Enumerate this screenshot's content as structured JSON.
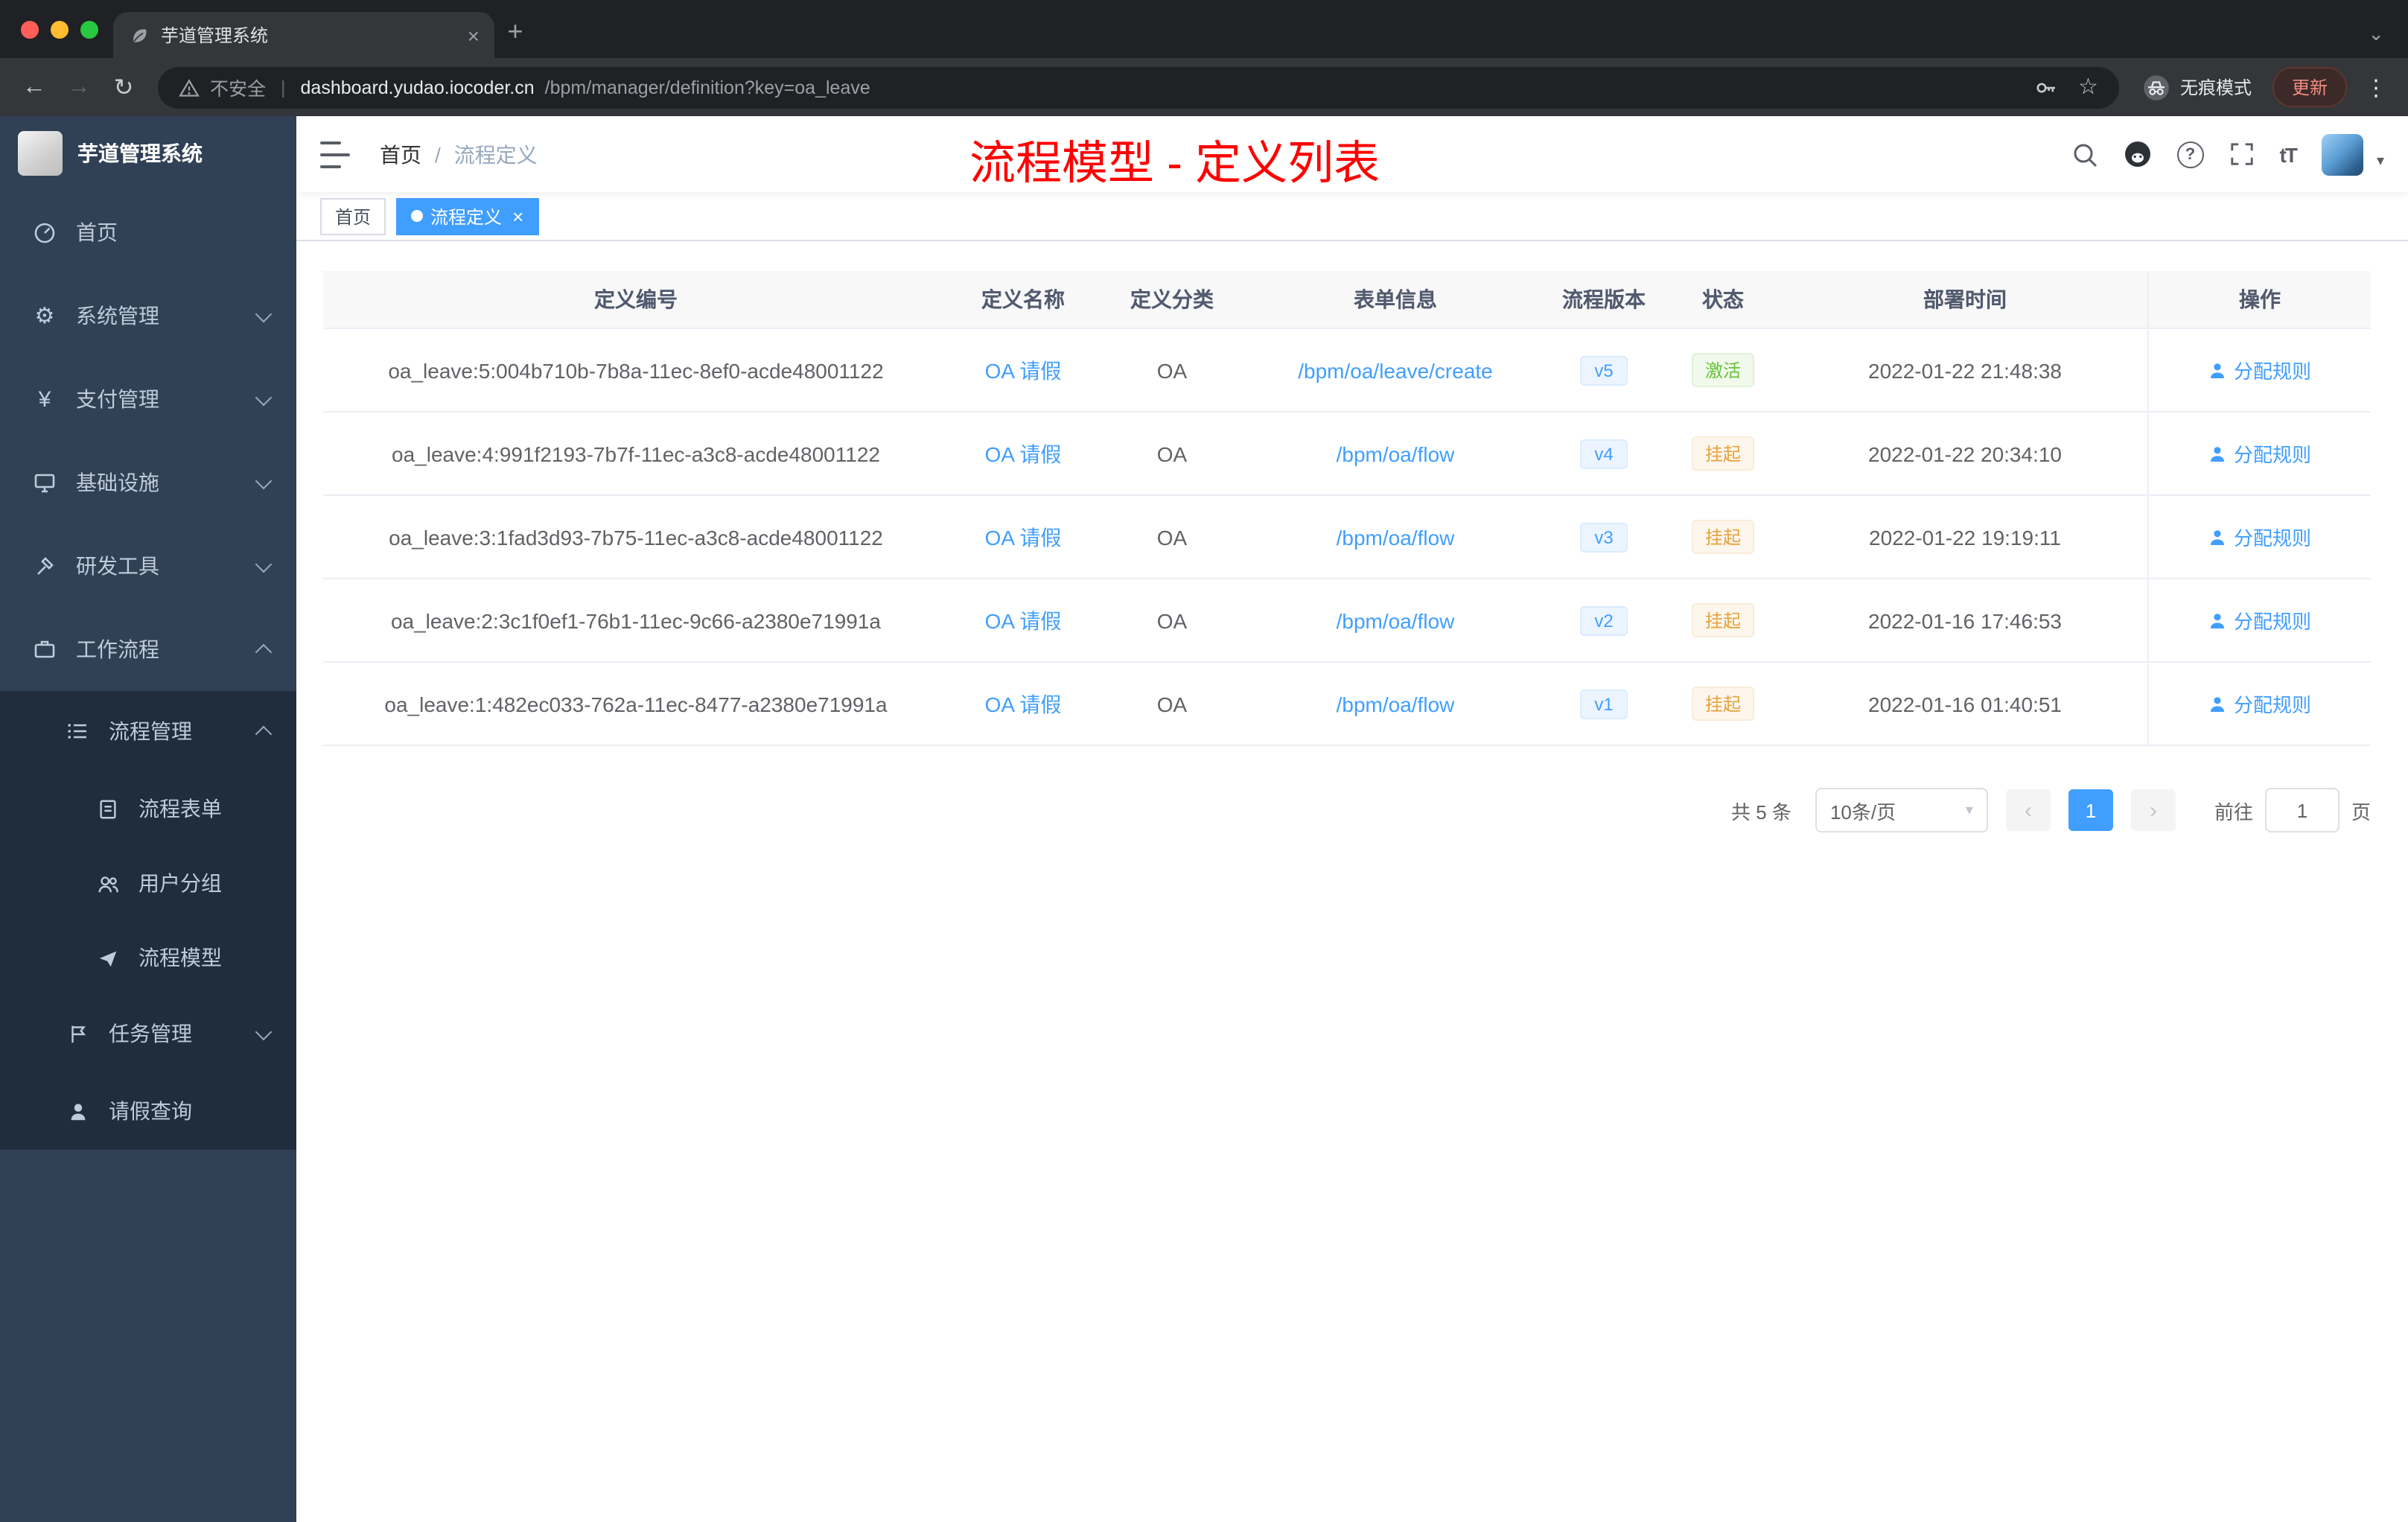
{
  "colors": {
    "accent": "#409eff",
    "success": "#67c23a",
    "warning": "#e6a23c",
    "annotation_red": "#ff0000",
    "sidebar_bg": "#304156",
    "sidebar_submenu_bg": "#1f2d3d"
  },
  "browser": {
    "tab_title": "芋道管理系统",
    "security_label": "不安全",
    "url_host": "dashboard.yudao.iocoder.cn",
    "url_path": "/bpm/manager/definition?key=oa_leave",
    "incognito_label": "无痕模式",
    "update_label": "更新"
  },
  "sidebar": {
    "title": "芋道管理系统",
    "items": [
      {
        "label": "首页"
      },
      {
        "label": "系统管理"
      },
      {
        "label": "支付管理"
      },
      {
        "label": "基础设施"
      },
      {
        "label": "研发工具"
      },
      {
        "label": "工作流程"
      }
    ],
    "workflow": {
      "process_mgmt": {
        "label": "流程管理"
      },
      "process_children": [
        {
          "label": "流程表单"
        },
        {
          "label": "用户分组"
        },
        {
          "label": "流程模型"
        }
      ],
      "task_mgmt": {
        "label": "任务管理"
      },
      "leave_query": {
        "label": "请假查询"
      }
    }
  },
  "navbar": {
    "breadcrumb_home": "首页",
    "breadcrumb_sep": "/",
    "breadcrumb_current": "流程定义",
    "annotation": "流程模型 - 定义列表",
    "font_icon": "tT"
  },
  "tags": [
    {
      "label": "首页"
    },
    {
      "label": "流程定义"
    }
  ],
  "table": {
    "columns": [
      "定义编号",
      "定义名称",
      "定义分类",
      "表单信息",
      "流程版本",
      "状态",
      "部署时间",
      "操作"
    ],
    "rows": [
      {
        "id": "oa_leave:5:004b710b-7b8a-11ec-8ef0-acde48001122",
        "name": "OA 请假",
        "category": "OA",
        "form": "/bpm/oa/leave/create",
        "version": "v5",
        "status": "激活",
        "deployed": "2022-01-22 21:48:38",
        "action": "分配规则"
      },
      {
        "id": "oa_leave:4:991f2193-7b7f-11ec-a3c8-acde48001122",
        "name": "OA 请假",
        "category": "OA",
        "form": "/bpm/oa/flow",
        "version": "v4",
        "status": "挂起",
        "deployed": "2022-01-22 20:34:10",
        "action": "分配规则"
      },
      {
        "id": "oa_leave:3:1fad3d93-7b75-11ec-a3c8-acde48001122",
        "name": "OA 请假",
        "category": "OA",
        "form": "/bpm/oa/flow",
        "version": "v3",
        "status": "挂起",
        "deployed": "2022-01-22 19:19:11",
        "action": "分配规则"
      },
      {
        "id": "oa_leave:2:3c1f0ef1-76b1-11ec-9c66-a2380e71991a",
        "name": "OA 请假",
        "category": "OA",
        "form": "/bpm/oa/flow",
        "version": "v2",
        "status": "挂起",
        "deployed": "2022-01-16 17:46:53",
        "action": "分配规则"
      },
      {
        "id": "oa_leave:1:482ec033-762a-11ec-8477-a2380e71991a",
        "name": "OA 请假",
        "category": "OA",
        "form": "/bpm/oa/flow",
        "version": "v1",
        "status": "挂起",
        "deployed": "2022-01-16 01:40:51",
        "action": "分配规则"
      }
    ]
  },
  "pagination": {
    "total": "共 5 条",
    "page_size": "10条/页",
    "current": "1",
    "prev": "‹",
    "next": "›",
    "goto_label": "前往",
    "goto_value": "1",
    "unit": "页"
  },
  "icons": {
    "close": "×",
    "plus": "+",
    "chevron_down": "⌄",
    "back": "←",
    "forward": "→",
    "reload": "↻",
    "star": "☆",
    "more": "⋮",
    "divider": "|",
    "yen": "¥",
    "gear": "⚙",
    "question": "?",
    "caret": "▾"
  }
}
